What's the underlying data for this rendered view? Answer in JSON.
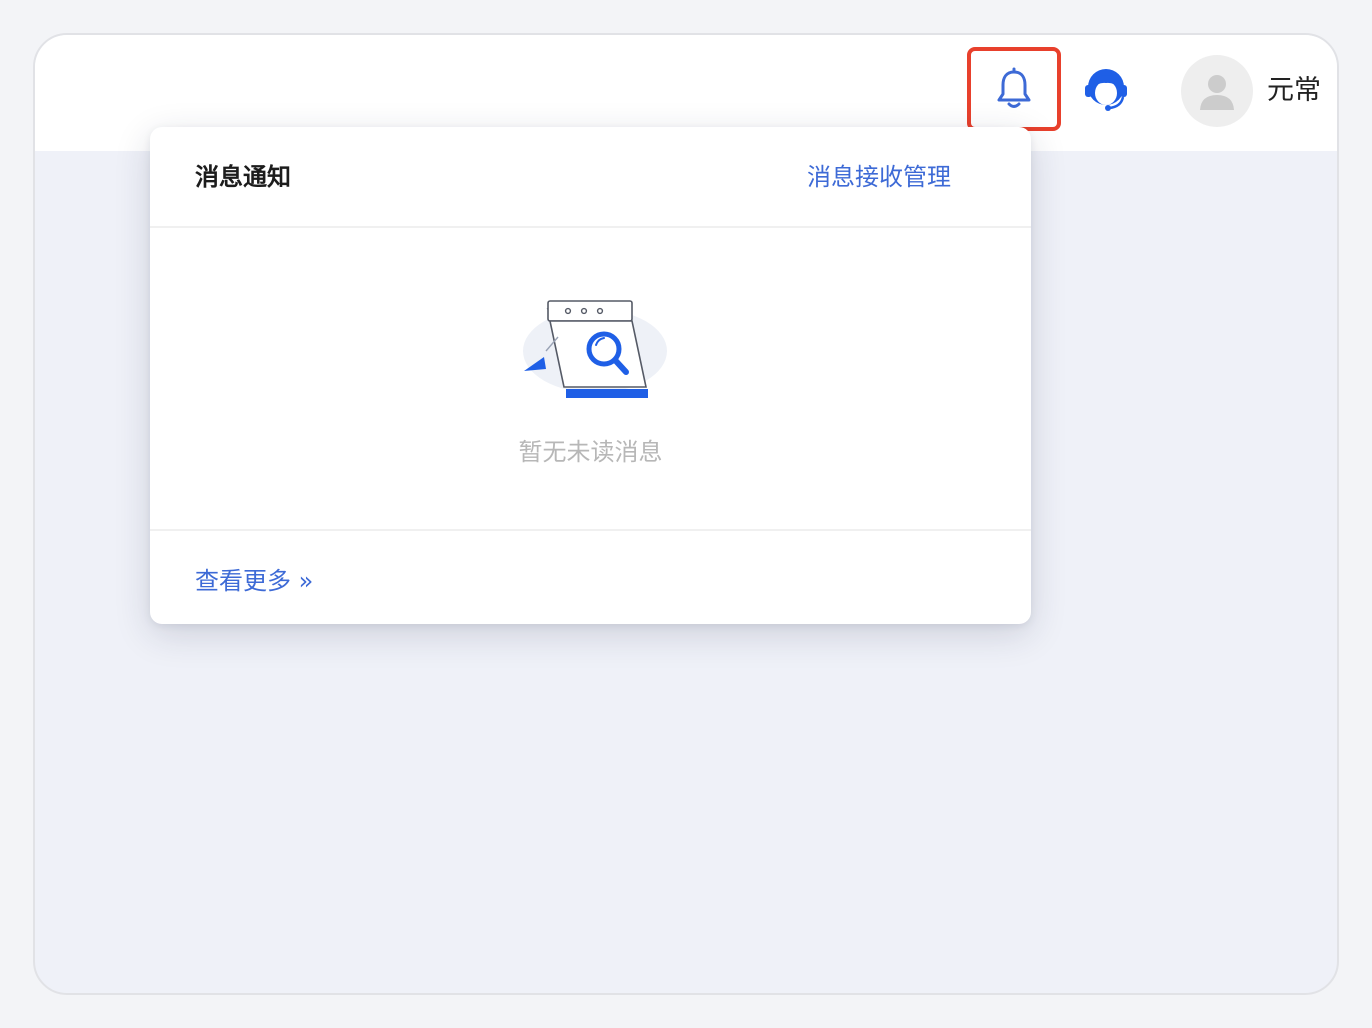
{
  "header": {
    "bell_icon": "bell-icon",
    "support_icon": "customer-service-icon",
    "avatar_icon": "user-avatar-icon",
    "username": "元常",
    "highlight_color": "#e8402c"
  },
  "notification_popover": {
    "title": "消息通知",
    "manage_link": "消息接收管理",
    "empty_illustration": "empty-calendar-search-illustration",
    "empty_text": "暂无未读消息",
    "more_link": "查看更多 »"
  },
  "colors": {
    "accent": "#3d6ad6",
    "brand_blue": "#1f5fe6",
    "muted_text": "#b7b7b7",
    "background": "#eff1f8"
  }
}
